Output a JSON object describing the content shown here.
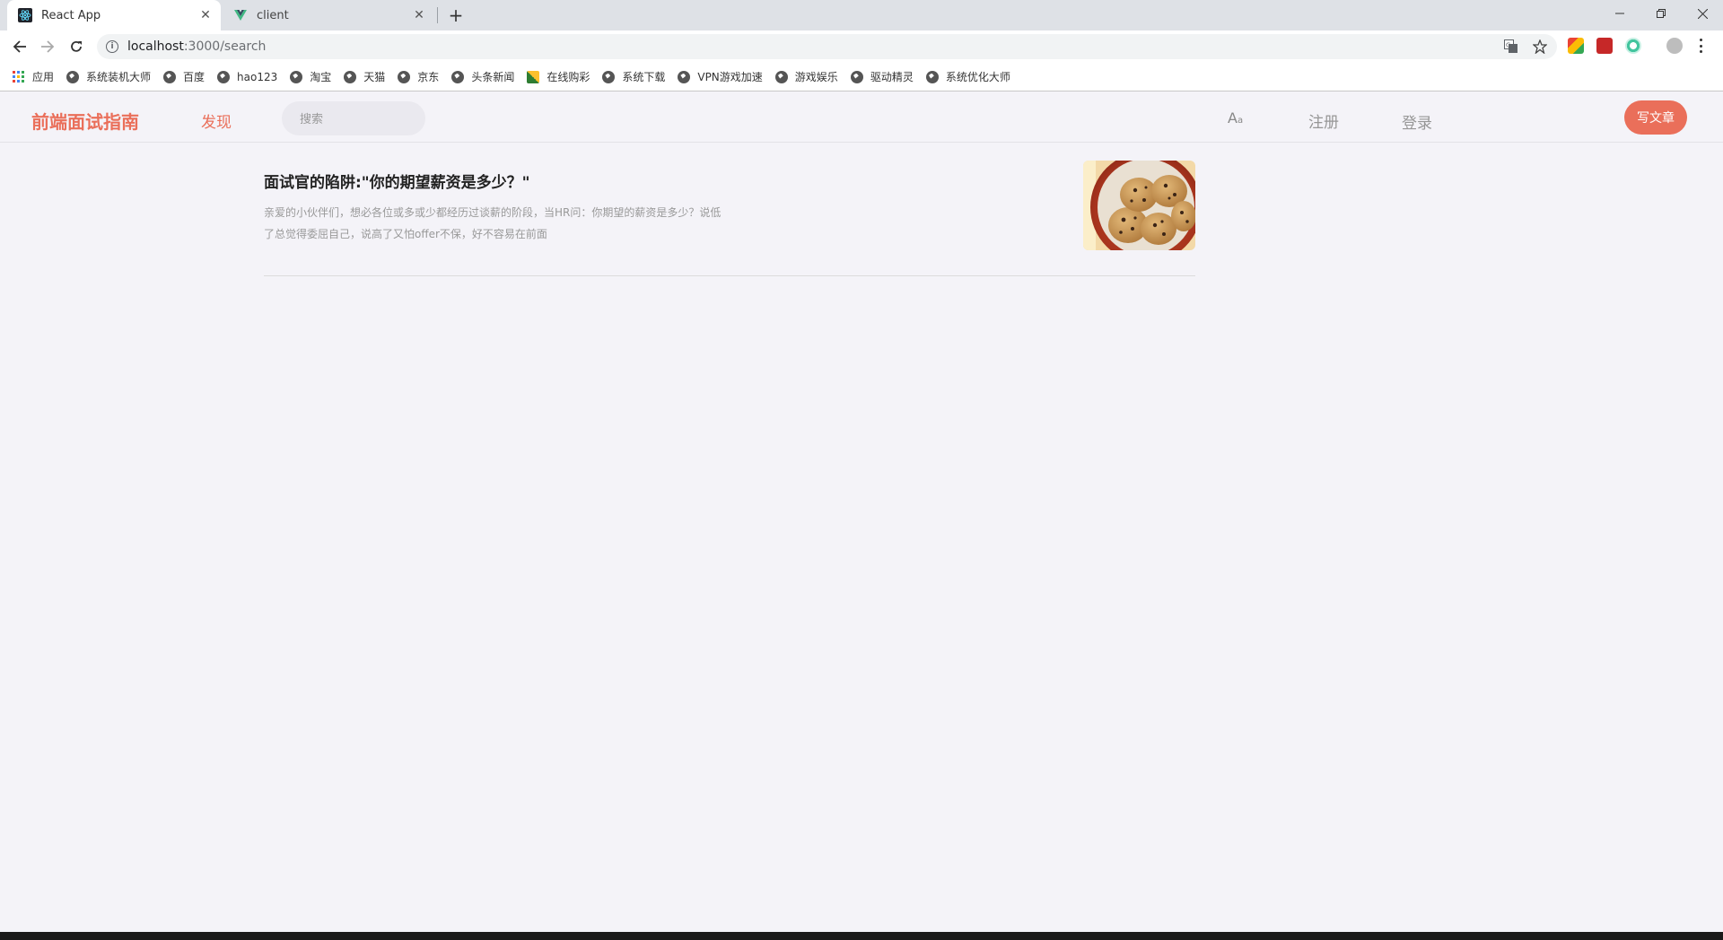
{
  "browser": {
    "tabs": [
      {
        "title": "React App",
        "active": true
      },
      {
        "title": "client",
        "active": false
      }
    ],
    "address": {
      "host": "localhost",
      "path": ":3000/search"
    },
    "bookmarks": [
      {
        "label": "应用",
        "icon": "apps-grid-icon"
      },
      {
        "label": "系统装机大师",
        "icon": "globe-icon"
      },
      {
        "label": "百度",
        "icon": "globe-icon"
      },
      {
        "label": "hao123",
        "icon": "globe-icon"
      },
      {
        "label": "淘宝",
        "icon": "globe-icon"
      },
      {
        "label": "天猫",
        "icon": "globe-icon"
      },
      {
        "label": "京东",
        "icon": "globe-icon"
      },
      {
        "label": "头条新闻",
        "icon": "globe-icon"
      },
      {
        "label": "在线购彩",
        "icon": "lottery-icon"
      },
      {
        "label": "系统下载",
        "icon": "globe-icon"
      },
      {
        "label": "VPN游戏加速",
        "icon": "globe-icon"
      },
      {
        "label": "游戏娱乐",
        "icon": "globe-icon"
      },
      {
        "label": "驱动精灵",
        "icon": "globe-icon"
      },
      {
        "label": "系统优化大师",
        "icon": "globe-icon"
      }
    ]
  },
  "header": {
    "logo": "前端面试指南",
    "nav_discover": "发现",
    "search_placeholder": "搜索",
    "font_toggle": "A",
    "font_toggle_small": "a",
    "register": "注册",
    "login": "登录",
    "write": "写文章"
  },
  "articles": [
    {
      "title": "面试官的陷阱:\"你的期望薪资是多少？\"",
      "description": "亲爱的小伙伴们，想必各位或多或少都经历过谈薪的阶段，当HR问：你期望的薪资是多少？说低了总觉得委屈自己，说高了又怕offer不保，好不容易在前面",
      "thumbnail": "cookies-image"
    }
  ],
  "colors": {
    "brand": "#ea6f5a",
    "page_bg": "#f4f3f8"
  }
}
